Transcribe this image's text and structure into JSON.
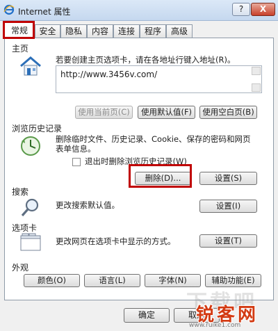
{
  "window": {
    "title": "Internet 属性",
    "help_label": "?",
    "close_label": "X"
  },
  "tabs": [
    {
      "label": "常规",
      "active": true
    },
    {
      "label": "安全"
    },
    {
      "label": "隐私"
    },
    {
      "label": "内容"
    },
    {
      "label": "连接"
    },
    {
      "label": "程序"
    },
    {
      "label": "高级"
    }
  ],
  "homepage": {
    "section_label": "主页",
    "description": "若要创建主页选项卡，请在各地址行键入地址(R)。",
    "url": "http://www.3456v.com/",
    "buttons": {
      "use_current": "使用当前页(C)",
      "use_default": "使用默认值(F)",
      "use_blank": "使用空白页(B)"
    }
  },
  "history": {
    "section_label": "浏览历史记录",
    "description_line1": "删除临时文件、历史记录、Cookie、保存的密码和网页",
    "description_line2": "表单信息。",
    "checkbox_label": "退出时删除浏览历史记录(W)",
    "buttons": {
      "delete": "删除(D)...",
      "settings": "设置(S)"
    }
  },
  "search": {
    "section_label": "搜索",
    "description": "更改搜索默认值。",
    "buttons": {
      "settings": "设置(I)"
    }
  },
  "tabs_section": {
    "section_label": "选项卡",
    "description": "更改网页在选项卡中显示的方式。",
    "buttons": {
      "settings": "设置(T)"
    }
  },
  "appearance": {
    "section_label": "外观",
    "buttons": {
      "colors": "颜色(O)",
      "languages": "语言(L)",
      "fonts": "字体(N)",
      "accessibility": "辅助功能(E)"
    }
  },
  "footer": {
    "ok": "确定",
    "cancel": "取消"
  },
  "watermark": {
    "text": "下载吧",
    "brand": "锐客网",
    "url": "www.ruike1.com"
  },
  "colors": {
    "highlight_box": "#c00000",
    "title_bar": "#c5d8ef",
    "close_button": "#c8412b"
  }
}
